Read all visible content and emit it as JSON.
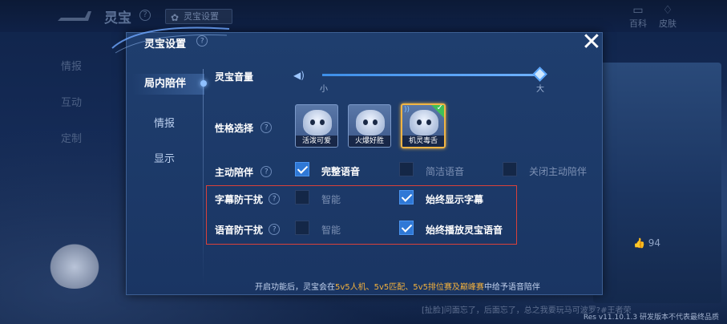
{
  "background": {
    "title": "灵宝",
    "settings_button": "灵宝设置",
    "top_right": [
      {
        "icon": "encyclopedia-icon",
        "label": "百科"
      },
      {
        "icon": "skin-icon",
        "label": "皮肤"
      }
    ],
    "nav": [
      "情报",
      "互动",
      "定制"
    ],
    "likes": "94",
    "bottom_text": "[扯脸]问面忘了，后面忘了，总之我要玩马可波罗?#王者荣",
    "version": "Res v11.10.1.3 研发版本不代表最终品质"
  },
  "modal": {
    "title": "灵宝设置",
    "close_label": "✕",
    "tabs": [
      {
        "label": "局内陪伴",
        "active": true
      },
      {
        "label": "情报",
        "active": false
      },
      {
        "label": "显示",
        "active": false
      }
    ],
    "volume": {
      "label": "灵宝音量",
      "min_label": "小",
      "max_label": "大",
      "level": 1.0
    },
    "personality": {
      "label": "性格选择",
      "options": [
        {
          "label": "活泼可爱",
          "selected": false
        },
        {
          "label": "火爆好胜",
          "selected": false
        },
        {
          "label": "机灵毒舌",
          "selected": true
        }
      ]
    },
    "companion": {
      "label": "主动陪伴",
      "options": [
        {
          "label": "完整语音",
          "checked": true
        },
        {
          "label": "简洁语音",
          "checked": false
        },
        {
          "label": "关闭主动陪伴",
          "checked": false
        }
      ]
    },
    "subtitle_guard": {
      "label": "字幕防干扰",
      "options": [
        {
          "label": "智能",
          "checked": false
        },
        {
          "label": "始终显示字幕",
          "checked": true
        }
      ]
    },
    "voice_guard": {
      "label": "语音防干扰",
      "options": [
        {
          "label": "智能",
          "checked": false
        },
        {
          "label": "始终播放灵宝语音",
          "checked": true
        }
      ]
    },
    "footer": {
      "prefix": "开启功能后，灵宝会在",
      "modes": "5v5人机、5v5匹配、5v5排位赛及巅峰赛",
      "suffix": "中给予语音陪伴"
    }
  },
  "colors": {
    "accent": "#2f78d6",
    "highlight": "#f2b13d",
    "selected_border": "#f1b544",
    "warning_box": "#d9413a"
  }
}
